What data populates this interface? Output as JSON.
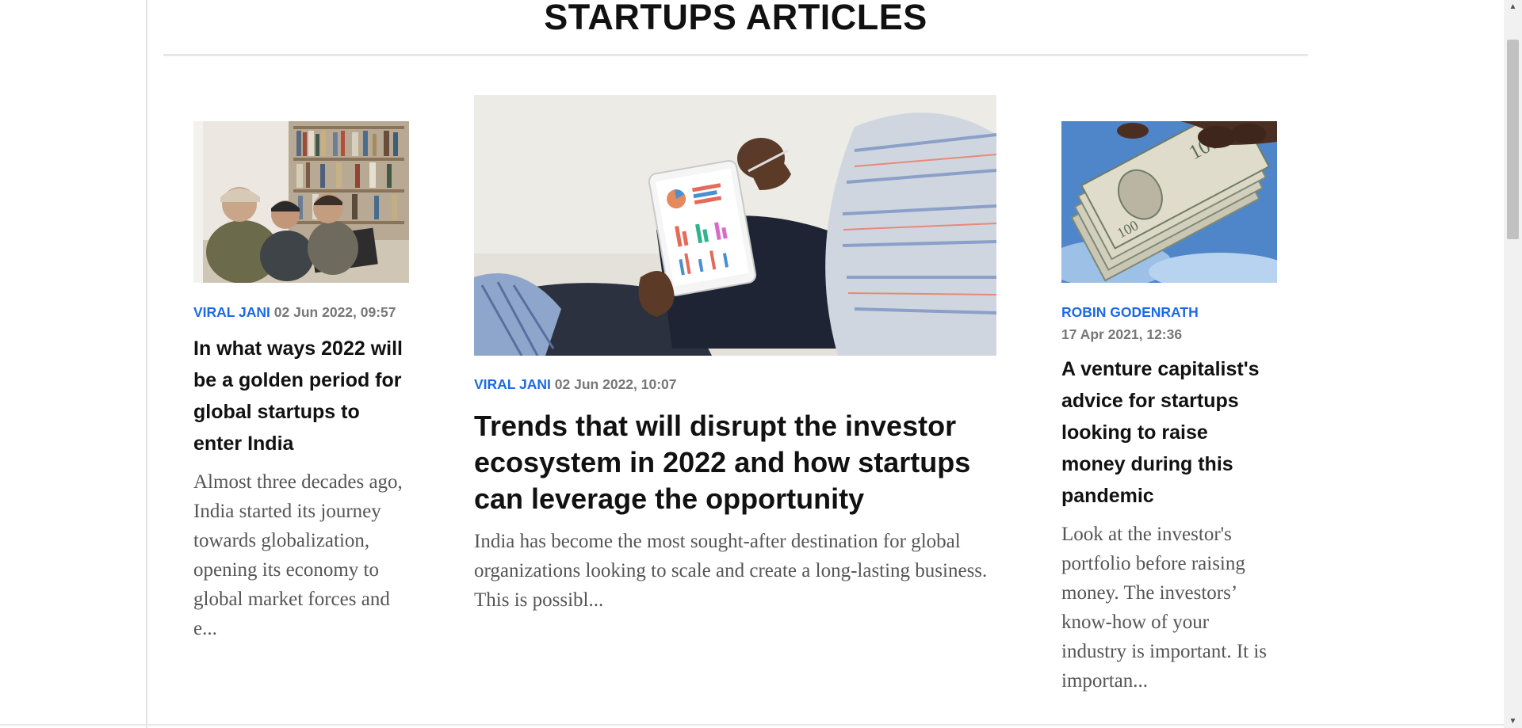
{
  "section": {
    "title": "STARTUPS ARTICLES"
  },
  "articles": [
    {
      "author": "VIRAL JANI",
      "date": "02 Jun 2022, 09:57",
      "headline": "In what ways 2022 will be a golden period for global startups to enter India",
      "excerpt": "Almost three decades ago, India started its journey towards globalization, opening its economy to global market forces and e...",
      "image": "team-of-coworkers-laughing-at-laptop-photo"
    },
    {
      "author": "VIRAL JANI",
      "date": "02 Jun 2022, 10:07",
      "headline": "Trends that will disrupt the investor ecosystem in 2022 and how startups can leverage the opportunity",
      "excerpt": "India has become the most sought-after destination for global organizations looking to scale and create a long-lasting business. This is possibl...",
      "image": "man-holding-tablet-with-charts-photo"
    },
    {
      "author": "ROBIN GODENRATH",
      "date": "17 Apr 2021, 12:36",
      "headline": "A venture capitalist's advice for startups looking to raise money during this pandemic",
      "excerpt": "Look at the investor's portfolio before raising money. The investors’ know-how of your industry is important. It is importan...",
      "image": "hand-holding-dollar-bills-photo"
    }
  ],
  "colors": {
    "author_link": "#1a6ae6",
    "meta_date": "#777777",
    "excerpt": "#555555",
    "title_rule": "#e2e8ee"
  },
  "scrollbar": {
    "up_icon": "triangle-up-icon",
    "down_icon": "triangle-down-icon"
  }
}
